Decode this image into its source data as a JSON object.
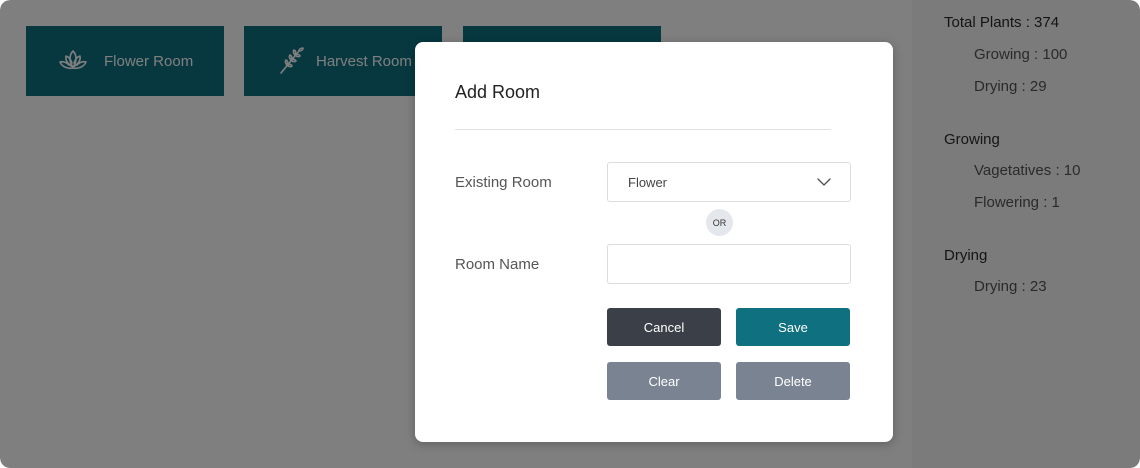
{
  "rooms": [
    {
      "label": "Flower Room",
      "icon": "lotus-icon"
    },
    {
      "label": "Harvest Room",
      "icon": "wheat-icon"
    },
    {
      "label": "",
      "icon": ""
    }
  ],
  "sidebar": {
    "total": "Total Plants : 374",
    "total_growing": "Growing : 100",
    "total_drying": "Drying : 29",
    "growing_heading": "Growing",
    "vegetatives": "Vagetatives : 10",
    "flowering": "Flowering : 1",
    "drying_heading": "Drying",
    "drying": "Drying : 23"
  },
  "modal": {
    "title": "Add Room",
    "existing_label": "Existing Room",
    "existing_value": "Flower",
    "or_text": "OR",
    "name_label": "Room Name",
    "name_value": "",
    "cancel_label": "Cancel",
    "save_label": "Save",
    "clear_label": "Clear",
    "delete_label": "Delete"
  },
  "colors": {
    "accent": "#0f7080",
    "dark_button": "#3a3f48",
    "muted_button": "#7a8392"
  }
}
